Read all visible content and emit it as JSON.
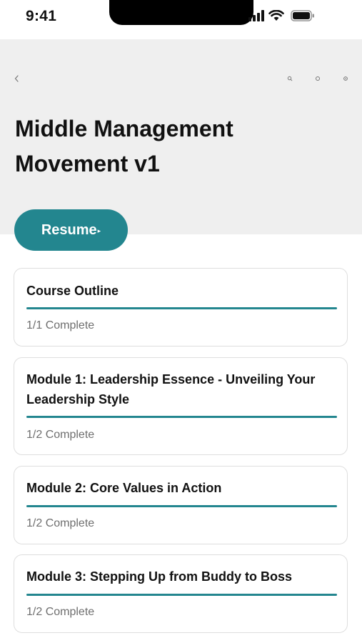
{
  "status_bar": {
    "time": "9:41"
  },
  "header": {
    "title": "Middle Management Movement v1"
  },
  "resume": {
    "label": "Resume",
    "arrow": "▸"
  },
  "accent_color": "#23868f",
  "cards": [
    {
      "title": "Course Outline",
      "status": "1/1 Complete",
      "progress_display": 1.0
    },
    {
      "title": "Module 1: Leadership Essence - Unveiling Your Leadership Style",
      "status": "1/2 Complete",
      "progress_display": 1.0
    },
    {
      "title": "Module 2: Core Values in Action",
      "status": "1/2 Complete",
      "progress_display": 1.0
    },
    {
      "title": "Module 3: Stepping Up from Buddy to Boss",
      "status": "1/2 Complete",
      "progress_display": 1.0
    }
  ]
}
